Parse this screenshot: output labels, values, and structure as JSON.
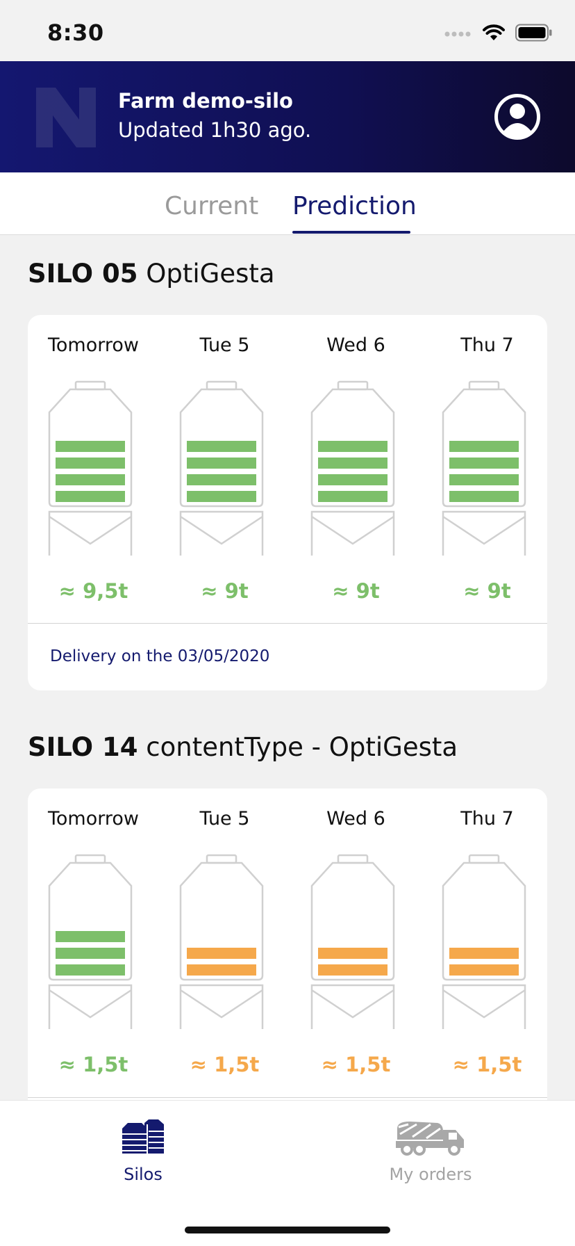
{
  "status_bar": {
    "time": "8:30",
    "icons": [
      "signal-icon",
      "wifi-icon",
      "battery-icon"
    ]
  },
  "header": {
    "farm_name": "Farm demo-silo",
    "updated": "Updated 1h30 ago.",
    "logo": "brand-logo",
    "profile_icon": "profile-icon"
  },
  "tabs": [
    {
      "label": "Current",
      "active": false
    },
    {
      "label": "Prediction",
      "active": true
    }
  ],
  "colors": {
    "accent": "#141a6e",
    "green": "#7dbf6a",
    "orange": "#f5a84b",
    "inactive": "#9a9a9a"
  },
  "silos": [
    {
      "id": "SILO 05",
      "name": "OptiGesta",
      "days": [
        {
          "day": "Tomorrow",
          "quantity": "≈ 9,5t",
          "bars": 4,
          "status": "green"
        },
        {
          "day": "Tue 5",
          "quantity": "≈ 9t",
          "bars": 4,
          "status": "green"
        },
        {
          "day": "Wed 6",
          "quantity": "≈ 9t",
          "bars": 4,
          "status": "green"
        },
        {
          "day": "Thu 7",
          "quantity": "≈ 9t",
          "bars": 4,
          "status": "green"
        }
      ],
      "delivery": "Delivery on the 03/05/2020"
    },
    {
      "id": "SILO 14",
      "name": "contentType - OptiGesta",
      "days": [
        {
          "day": "Tomorrow",
          "quantity": "≈ 1,5t",
          "bars": 3,
          "status": "green"
        },
        {
          "day": "Tue 5",
          "quantity": "≈ 1,5t",
          "bars": 2,
          "status": "orange"
        },
        {
          "day": "Wed 6",
          "quantity": "≈ 1,5t",
          "bars": 2,
          "status": "orange"
        },
        {
          "day": "Thu 7",
          "quantity": "≈ 1,5t",
          "bars": 2,
          "status": "orange"
        }
      ]
    }
  ],
  "nav": [
    {
      "label": "Silos",
      "icon": "silos-icon",
      "active": true
    },
    {
      "label": "My orders",
      "icon": "truck-icon",
      "active": false
    }
  ]
}
